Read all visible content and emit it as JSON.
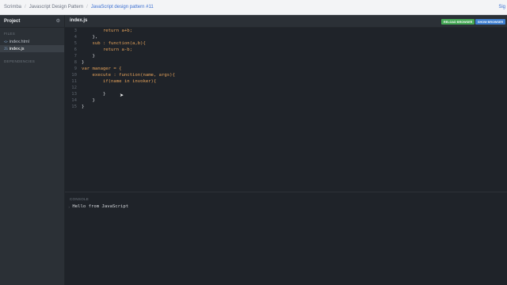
{
  "breadcrumb": {
    "items": [
      "Scrimba",
      "Javascript Design Pattern",
      "JavaScript design pattern #11"
    ],
    "sign_in": "Sig"
  },
  "sidebar": {
    "title": "Project",
    "files_header": "FILES",
    "files": [
      {
        "name": "index.html",
        "selected": false
      },
      {
        "name": "index.js",
        "selected": true
      }
    ],
    "dependencies_header": "DEPENDENCIES"
  },
  "editor": {
    "active_tab": "index.js",
    "reload_label": "RELOAD BROWSER",
    "show_label": "SHOW BROWSER",
    "lines": [
      {
        "num": "3",
        "text": "        return a+b;"
      },
      {
        "num": "4",
        "text": "    },"
      },
      {
        "num": "5",
        "text": "    sub : function(a,b){"
      },
      {
        "num": "6",
        "text": "        return a-b;"
      },
      {
        "num": "7",
        "text": "    }"
      },
      {
        "num": "8",
        "text": "}"
      },
      {
        "num": "9",
        "text": "var manager = {"
      },
      {
        "num": "10",
        "text": "    execute : function(name, args){"
      },
      {
        "num": "11",
        "text": "        if(name in invoker){"
      },
      {
        "num": "12",
        "text": ""
      },
      {
        "num": "13",
        "text": "        }"
      },
      {
        "num": "14",
        "text": "    }"
      },
      {
        "num": "15",
        "text": "}"
      }
    ]
  },
  "console": {
    "title": "CONSOLE",
    "output": "Hello from JavaScript"
  },
  "colors": {
    "accent": "#3b6fd1",
    "reload_button": "#45a855",
    "show_button": "#3e7fd0",
    "keyword": "#e5a25a"
  }
}
